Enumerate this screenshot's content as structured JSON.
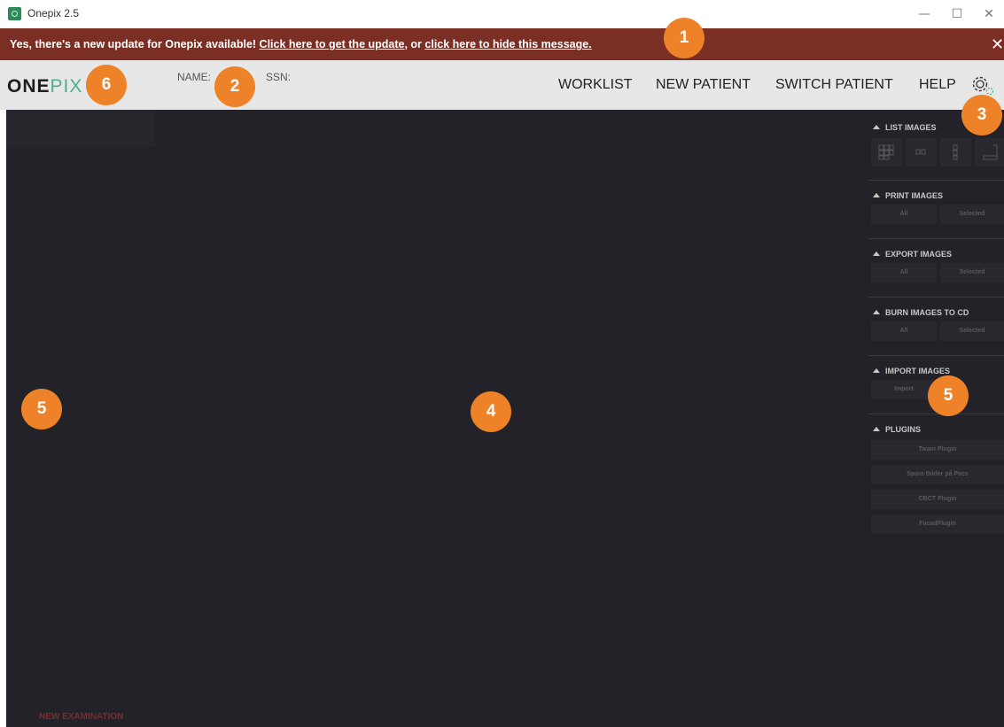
{
  "window": {
    "title": "Onepix 2.5",
    "controls": {
      "minimize": "—",
      "maximize": "☐",
      "close": "✕"
    }
  },
  "banner": {
    "text_prefix": "Yes, there's a new update for Onepix available! ",
    "update_link": "Click here to get the update",
    "text_middle": ", or ",
    "hide_link": "click here to hide this message.",
    "close": "✕",
    "color": "#7a2e24"
  },
  "header": {
    "logo_one": "ONE",
    "logo_pix": "PIX",
    "name_label": "NAME:",
    "ssn_label": "SSN:",
    "nav": {
      "worklist": "WORKLIST",
      "new_patient": "NEW PATIENT",
      "switch_patient": "SWITCH PATIENT",
      "help": "HELP"
    },
    "settings_icon": "gear-icon"
  },
  "main": {
    "background": "#232228",
    "new_examination": "NEW EXAMINATION"
  },
  "right_panel": {
    "list_images": {
      "title": "LIST IMAGES",
      "layout_icons": [
        "grid-view-icon",
        "film-strip-icon",
        "vertical-list-icon",
        "stack-view-icon"
      ]
    },
    "print_images": {
      "title": "PRINT IMAGES",
      "all": "All",
      "selected": "Selected"
    },
    "export_images": {
      "title": "EXPORT IMAGES",
      "all": "All",
      "selected": "Selected"
    },
    "burn_images": {
      "title": "BURN IMAGES TO CD",
      "all": "All",
      "selected": "Selected"
    },
    "import_images": {
      "title": "IMPORT IMAGES",
      "import": "Import"
    },
    "plugins": {
      "title": "PLUGINS",
      "items": [
        "Twain Plugin",
        "Spara Bilder på Pacs",
        "CBCT Plugin",
        "FacadPlugin"
      ]
    }
  },
  "callouts": [
    "1",
    "2",
    "3",
    "4",
    "5",
    "5",
    "6"
  ],
  "colors": {
    "accent_orange": "#ee8228",
    "logo_green": "#4fae88",
    "header_bg": "#e7e7e7"
  }
}
